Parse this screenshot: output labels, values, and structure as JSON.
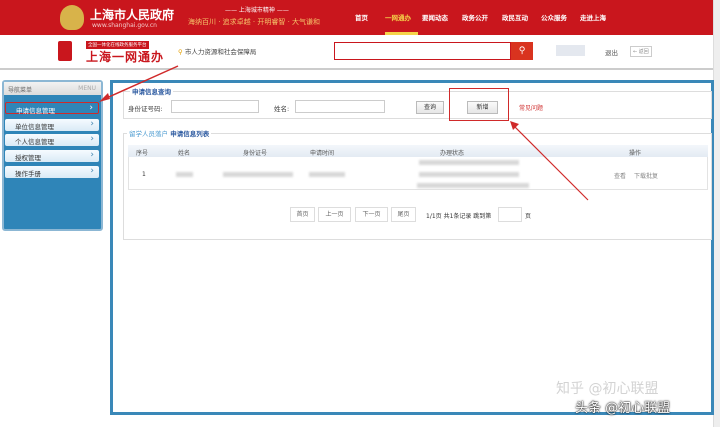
{
  "header": {
    "site_title": "上海市人民政府",
    "site_url": "www.shanghai.gov.cn",
    "slogan_title": "—— 上海城市精神 ——",
    "slogan": "海纳百川 · 追求卓越 · 开明睿智 · 大气谦和",
    "nav": [
      "首页",
      "一网通办",
      "要闻动态",
      "政务公开",
      "政民互动",
      "公众服务",
      "走进上海"
    ],
    "active_nav": "一网通办"
  },
  "subheader": {
    "badge": "全国一体化在线政务服务平台",
    "brand": "上海一网通办",
    "location": "市人力资源和社会保障局",
    "search_placeholder": "",
    "logout": "退出",
    "back": "← 返回"
  },
  "sidebar": {
    "title": "导航菜单",
    "title_en": "MENU",
    "items": [
      {
        "label": "申请信息管理",
        "active": true
      },
      {
        "label": "单位信息管理"
      },
      {
        "label": "个人信息管理"
      },
      {
        "label": "授权管理"
      },
      {
        "label": "操作手册"
      }
    ]
  },
  "query": {
    "legend": "申请信息查询",
    "id_label": "身份证号码:",
    "id_value": "",
    "name_label": "姓名:",
    "name_value": "",
    "search_btn": "查询",
    "add_btn": "新增",
    "faq": "常见问题"
  },
  "list": {
    "legend_prefix": "留学人员落户",
    "legend": "申请信息列表",
    "columns": [
      "序号",
      "姓名",
      "身份证号",
      "申请时间",
      "办理状态",
      "操作"
    ],
    "rows": [
      {
        "index": "1",
        "actions": [
          "查看",
          "下载批复"
        ]
      }
    ]
  },
  "pagination": {
    "first": "首页",
    "prev": "上一页",
    "next": "下一页",
    "last": "尾页",
    "info": "1/1页 共1条记录 跳到第",
    "page_suffix": "页",
    "jump_value": ""
  },
  "watermark": {
    "line1": "知乎 @初心联盟",
    "line2": "头条 @初心联盟"
  },
  "colors": {
    "brand_red": "#c9161d",
    "panel_blue": "#3a88b8"
  }
}
